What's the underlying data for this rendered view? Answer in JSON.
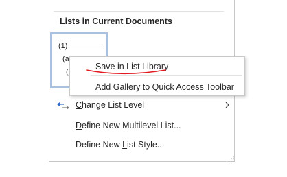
{
  "section": {
    "title": "Lists in Current Documents"
  },
  "thumbnail": {
    "line1": "(1)",
    "line2": "(a",
    "line3": "("
  },
  "context_menu": {
    "items": [
      {
        "label": "Save in List Library",
        "accel": "",
        "annotated": true
      },
      {
        "label": "Add Gallery to Quick Access Toolbar",
        "accel": "A"
      }
    ]
  },
  "menu": {
    "items": [
      {
        "label": "Change List Level",
        "accel": "C",
        "icon": "indent-arrows-icon",
        "submenu": true
      },
      {
        "label": "Define New Multilevel List...",
        "accel": "D"
      },
      {
        "label": "Define New List Style...",
        "accel": "L"
      }
    ]
  },
  "colors": {
    "thumbnail_border": "#a9c0df",
    "annotation_red": "#e21b23",
    "icon_blue": "#2e6bc6"
  }
}
